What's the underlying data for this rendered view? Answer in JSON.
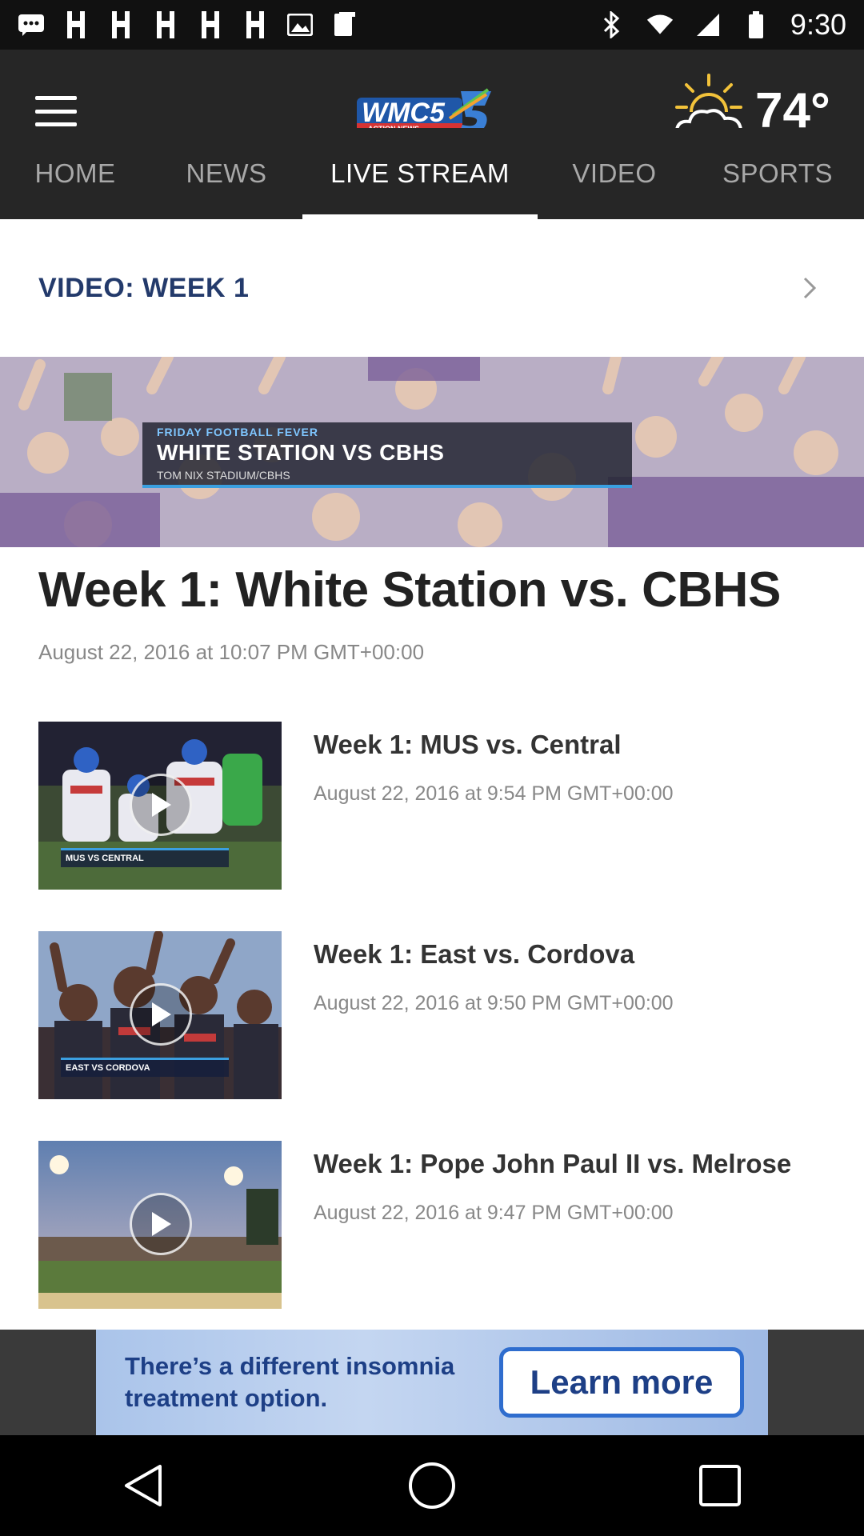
{
  "status_bar": {
    "time": "9:30",
    "icons": [
      "messages-icon",
      "app-notification-icon",
      "app-notification-icon",
      "app-notification-icon",
      "app-notification-icon",
      "app-notification-icon",
      "image-icon",
      "gallery-icon",
      "bluetooth-icon",
      "wifi-icon",
      "cell-signal-icon",
      "battery-icon"
    ]
  },
  "header": {
    "logo_text": "WMC5",
    "logo_sub": "ACTION NEWS",
    "temperature": "74°",
    "weather_icon": "partly-cloudy-icon"
  },
  "tabs": [
    {
      "label": "HOME",
      "active": false
    },
    {
      "label": "NEWS",
      "active": false
    },
    {
      "label": "LIVE STREAM",
      "active": true
    },
    {
      "label": "VIDEO",
      "active": false
    },
    {
      "label": "SPORTS",
      "active": false
    }
  ],
  "section": {
    "title": "VIDEO: WEEK 1"
  },
  "hero": {
    "overlay_small": "FRIDAY FOOTBALL FEVER",
    "overlay_big": "WHITE STATION VS CBHS",
    "overlay_sub": "TOM NIX STADIUM/CBHS"
  },
  "feature": {
    "title": "Week 1: White Station vs. CBHS",
    "date": "August 22, 2016 at 10:07 PM GMT+00:00"
  },
  "videos": [
    {
      "title": "Week 1: MUS vs. Central",
      "date": "August 22, 2016 at 9:54 PM GMT+00:00",
      "thumb_label": "MUS VS CENTRAL"
    },
    {
      "title": "Week 1: East vs. Cordova",
      "date": "August 22, 2016 at 9:50 PM GMT+00:00",
      "thumb_label": "EAST VS CORDOVA"
    },
    {
      "title": "Week 1: Pope John Paul II vs. Melrose",
      "date": "August 22, 2016 at 9:47 PM GMT+00:00",
      "thumb_label": ""
    }
  ],
  "ad": {
    "text": "There’s a different insomnia treatment option.",
    "button": "Learn more"
  },
  "colors": {
    "header_bg": "#262626",
    "section_title": "#233a6b",
    "ad_blue": "#1d3f86"
  }
}
